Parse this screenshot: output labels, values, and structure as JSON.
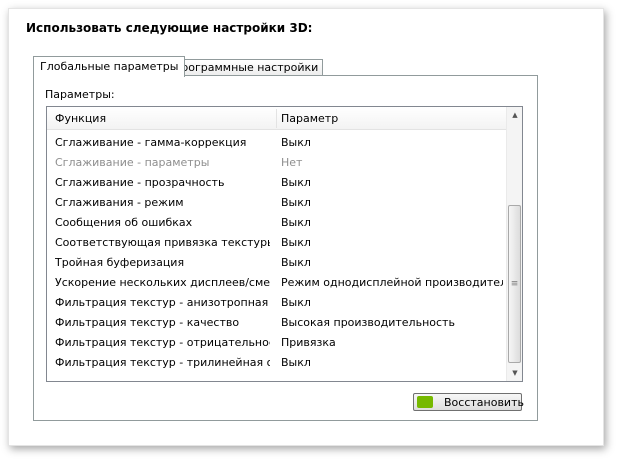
{
  "title": "Использовать следующие настройки 3D:",
  "tabs": [
    {
      "label": "Глобальные параметры",
      "active": true
    },
    {
      "label": "Программные настройки",
      "active": false
    }
  ],
  "params_label": "Параметры:",
  "columns": [
    "Функция",
    "Параметр"
  ],
  "rows": [
    {
      "feature": "Сглаживание - гамма-коррекция",
      "value": "Выкл",
      "disabled": false
    },
    {
      "feature": "Сглаживание - параметры",
      "value": "Нет",
      "disabled": true
    },
    {
      "feature": "Сглаживание - прозрачность",
      "value": "Выкл",
      "disabled": false
    },
    {
      "feature": "Сглаживания - режим",
      "value": "Выкл",
      "disabled": false
    },
    {
      "feature": "Сообщения об ошибках",
      "value": "Выкл",
      "disabled": false
    },
    {
      "feature": "Соответствующая привязка текстуры",
      "value": "Выкл",
      "disabled": false
    },
    {
      "feature": "Тройная буферизация",
      "value": "Выкл",
      "disabled": false
    },
    {
      "feature": "Ускорение нескольких дисплеев/смеша...",
      "value": "Режим однодисплейной производитель...",
      "disabled": false
    },
    {
      "feature": "Фильтрация текстур - анизотропная оп...",
      "value": "Выкл",
      "disabled": false
    },
    {
      "feature": "Фильтрация текстур - качество",
      "value": "Высокая производительность",
      "disabled": false
    },
    {
      "feature": "Фильтрация текстур - отрицательное о...",
      "value": "Привязка",
      "disabled": false
    },
    {
      "feature": "Фильтрация текстур - трилинейная опт...",
      "value": "Выкл",
      "disabled": false
    }
  ],
  "restore_label": "Восстановить",
  "scroll_position_pct": 100,
  "accent": "#76b900"
}
